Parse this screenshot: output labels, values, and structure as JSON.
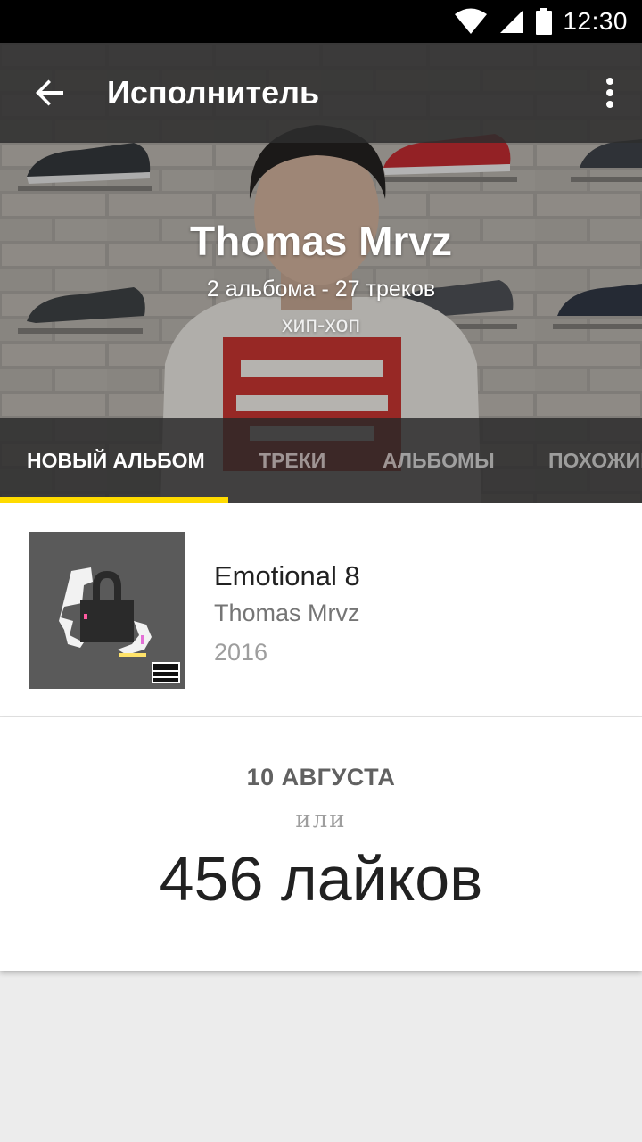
{
  "status_bar": {
    "time": "12:30",
    "icons": [
      "wifi-icon",
      "cell-signal-icon",
      "battery-icon"
    ]
  },
  "app_bar": {
    "title": "Исполнитель",
    "back_icon": "arrow-back-icon",
    "menu_icon": "more-vert-icon"
  },
  "artist": {
    "name": "Thomas Mrvz",
    "stats": "2 альбома - 27 треков",
    "genre": "хип-хоп"
  },
  "tabs": [
    {
      "label": "НОВЫЙ АЛЬБОМ",
      "active": true
    },
    {
      "label": "ТРЕКИ",
      "active": false
    },
    {
      "label": "АЛЬБОМЫ",
      "active": false
    },
    {
      "label": "ПОХОЖИЕ",
      "active": false
    }
  ],
  "album": {
    "title": "Emotional 8",
    "artist": "Thomas Mrvz",
    "year": "2016",
    "cover_badge": "PARENTAL ADVISORY"
  },
  "release": {
    "date": "10 АВГУСТА",
    "or": "или",
    "likes": "456 лайков"
  },
  "colors": {
    "accent": "#ffdb00",
    "status_bar": "#000000",
    "app_bar": "#2d2d2d",
    "background": "#ececec"
  }
}
